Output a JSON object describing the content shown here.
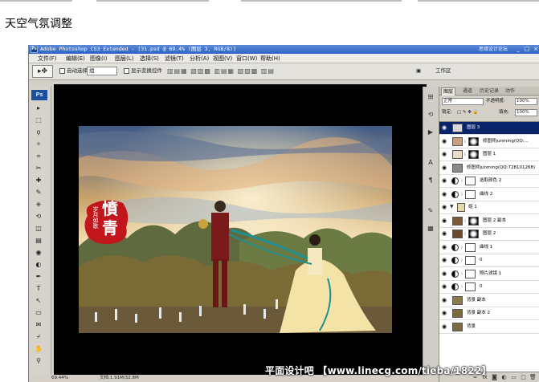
{
  "caption": "天空气氛调整",
  "window": {
    "title": "Adobe Photoshop CS3 Extended - [31.psd @ 69.4% (图层 3, RGB/8)]",
    "icon_text": "Ps",
    "brand": "思缘设计论坛",
    "buttons": {
      "minimize": "_",
      "maximize": "□",
      "close": "×"
    }
  },
  "menu": [
    "文件(F)",
    "编辑(E)",
    "图像(I)",
    "图层(L)",
    "选择(S)",
    "滤镜(T)",
    "分析(A)",
    "视图(V)",
    "窗口(W)",
    "帮助(H)"
  ],
  "options": {
    "auto_select_label": "自动选择:",
    "auto_select_value": "组",
    "show_transform_label": "显示变换控件",
    "workspace_label": "工作区"
  },
  "toolbox": {
    "logo": "Ps",
    "tools": [
      "move-icon",
      "marquee-icon",
      "lasso-icon",
      "magic-wand-icon",
      "crop-icon",
      "slice-icon",
      "healing-icon",
      "brush-icon",
      "clone-stamp-icon",
      "history-brush-icon",
      "eraser-icon",
      "gradient-icon",
      "blur-icon",
      "dodge-icon",
      "pen-icon",
      "type-icon",
      "path-select-icon",
      "shape-icon",
      "notes-icon",
      "eyedropper-icon",
      "hand-icon",
      "zoom-icon"
    ],
    "glyphs": [
      "▸",
      "⬚",
      "ϙ",
      "✧",
      "⌗",
      "✂",
      "✚",
      "✎",
      "⎈",
      "⟲",
      "◫",
      "▤",
      "◉",
      "◐",
      "✒",
      "T",
      "↖",
      "▭",
      "✉",
      "⌿",
      "✋",
      "⚲"
    ]
  },
  "status": {
    "zoom": "69.44%",
    "doc": "文档:1.91M/32.8M"
  },
  "image_text": {
    "stamp_char1": "憤",
    "stamp_char2": "青",
    "stamp_side": "岁月如歌"
  },
  "watermark": "平面设计吧 【www.linecg.com/tieba/1822】",
  "layers_panel": {
    "tabs": [
      "图层",
      "通道",
      "历史记录",
      "动作"
    ],
    "blend_mode": "正常",
    "opacity_label": "不透明度:",
    "opacity": "100%",
    "lock_label": "锁定:",
    "fill_label": "填充:",
    "fill": "100%",
    "layers": [
      {
        "name": "图层 3",
        "type": "pixel",
        "selected": true,
        "thumb": "#d9d9d9"
      },
      {
        "name": "修图师junming(QQ:...",
        "type": "masked",
        "thumb": "#c8a080"
      },
      {
        "name": "图层 1",
        "type": "masked",
        "thumb": "#e8dcc8"
      },
      {
        "name": "修图师junming(QQ:728101268)",
        "type": "pixel",
        "thumb": "#8a8a8a"
      },
      {
        "name": "选取颜色 2",
        "type": "adjust"
      },
      {
        "name": "曲线 2",
        "type": "adjust"
      },
      {
        "name": "组 1",
        "type": "group"
      },
      {
        "name": "图层 2 副本",
        "type": "masked",
        "thumb": "#7a5a3a"
      },
      {
        "name": "图层 2",
        "type": "masked",
        "thumb": "#6a4a30"
      },
      {
        "name": "曲线 1",
        "type": "adjust"
      },
      {
        "name": "0",
        "type": "adjust"
      },
      {
        "name": "照片滤镜 1",
        "type": "adjust"
      },
      {
        "name": "0",
        "type": "adjust"
      },
      {
        "name": "背景 副本",
        "type": "pixel",
        "thumb": "#8a7a50"
      },
      {
        "name": "背景 副本 2",
        "type": "pixel",
        "thumb": "#7a6a40"
      },
      {
        "name": "背景",
        "type": "pixel",
        "thumb": "#7a6a45"
      }
    ],
    "bottom_icons": [
      "link-icon",
      "fx-icon",
      "mask-icon",
      "adjustment-icon",
      "folder-icon",
      "new-layer-icon",
      "trash-icon"
    ],
    "bottom_glyphs": [
      "∞",
      "fx",
      "◙",
      "◐",
      "▭",
      "▢",
      "🗑"
    ]
  },
  "colors": {
    "title_bar": "#2f63c4",
    "selected_layer": "#0a246a",
    "stamp_red": "#c0161c"
  }
}
